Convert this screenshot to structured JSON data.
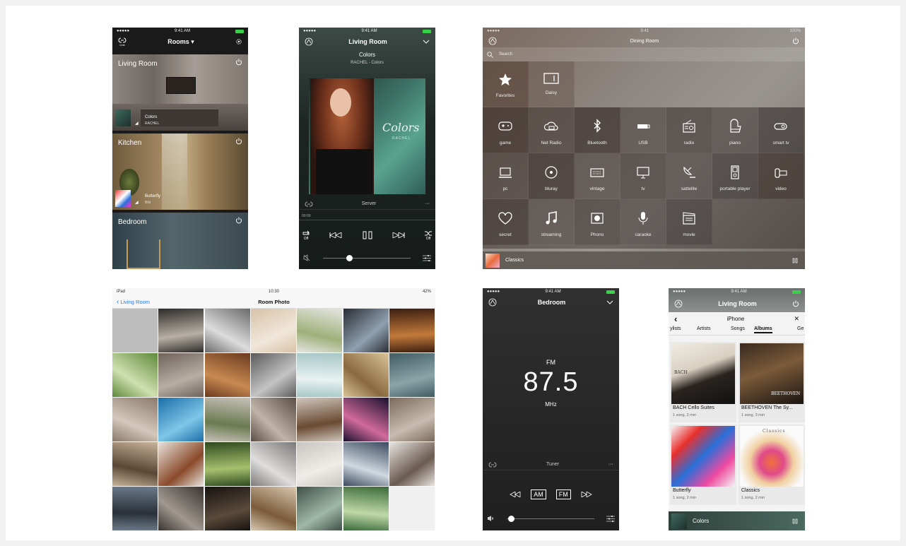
{
  "screen1": {
    "status": {
      "carrier": "●●●●● ",
      "time": "9:41 AM"
    },
    "header": {
      "link_label": "Link",
      "title": "Rooms ▾"
    },
    "rooms": [
      {
        "name": "Living Room",
        "track": "Colors",
        "artist": "RACHEL"
      },
      {
        "name": "Kitchen",
        "track": "Butterfly",
        "artist": "Bild"
      },
      {
        "name": "Bedroom"
      }
    ]
  },
  "screen2": {
    "status": {
      "carrier": "●●●●● ",
      "time": "9:41 AM"
    },
    "header": {
      "title": "Living Room"
    },
    "track": {
      "title": "Colors",
      "subtitle": "RACHEL - Colors"
    },
    "album_art_text": {
      "title": "Colors",
      "artist": "RACHEL"
    },
    "source_label": "Server",
    "more_label": "···",
    "elapsed": "00:00",
    "repeat_label": "Off",
    "shuffle_label": "Off",
    "volume": 0.3
  },
  "screen3": {
    "status": {
      "time": "9:41",
      "battery": "100%"
    },
    "header": {
      "title": "Dining Room"
    },
    "search": {
      "placeholder": "Search"
    },
    "top_items": [
      {
        "label": "Favorites",
        "icon": "star-icon"
      },
      {
        "label": "Daisy",
        "icon": "device-icon"
      }
    ],
    "sources": [
      {
        "label": "game",
        "icon": "gamepad-icon"
      },
      {
        "label": "Net Radio",
        "icon": "cloud-radio-icon"
      },
      {
        "label": "Bluetooth",
        "icon": "bluetooth-icon"
      },
      {
        "label": "USB",
        "icon": "usb-icon"
      },
      {
        "label": "radio",
        "icon": "radio-icon"
      },
      {
        "label": "piano",
        "icon": "piano-icon"
      },
      {
        "label": "smart tv",
        "icon": "smart-tv-icon"
      },
      {
        "label": "pc",
        "icon": "laptop-icon"
      },
      {
        "label": "bluray",
        "icon": "disc-icon"
      },
      {
        "label": "vintage",
        "icon": "vintage-icon"
      },
      {
        "label": "tv",
        "icon": "tv-icon"
      },
      {
        "label": "sattelite",
        "icon": "satellite-icon"
      },
      {
        "label": "portable player",
        "icon": "portable-player-icon"
      },
      {
        "label": "video",
        "icon": "video-icon"
      },
      {
        "label": "secret",
        "icon": "heart-icon"
      },
      {
        "label": "streaming",
        "icon": "music-note-icon"
      },
      {
        "label": "Phono",
        "icon": "phono-icon"
      },
      {
        "label": "caraoke",
        "icon": "microphone-icon"
      },
      {
        "label": "movie",
        "icon": "clapper-icon"
      }
    ],
    "now_playing": {
      "title": "Classics"
    }
  },
  "screen4": {
    "status": {
      "device": "iPad",
      "time": "10:30",
      "battery": "42%"
    },
    "back_label": "Living Room",
    "title": "Room Photo"
  },
  "screen5": {
    "status": {
      "carrier": "●●●●● ",
      "time": "9:41 AM"
    },
    "header": {
      "title": "Bedroom"
    },
    "band": "FM",
    "frequency": "87.5",
    "unit": "MHz",
    "source_label": "Tuner",
    "more_label": "···",
    "am_label": "AM",
    "fm_label": "FM",
    "volume": 0.05
  },
  "screen6": {
    "status": {
      "carrier": "●●●●● ",
      "time": "9:41 AM"
    },
    "header": {
      "title": "Living Room"
    },
    "subheader": {
      "title": "iPhone"
    },
    "tabs": [
      "ylists",
      "Artists",
      "Songs",
      "Albums",
      "Ge"
    ],
    "active_tab": "Albums",
    "albums": [
      {
        "title": "BACH Cello Suites",
        "meta": "1 song, 2 min",
        "cover_text": "BACH"
      },
      {
        "title": "BEETHOVEN  The Sy...",
        "meta": "1 song, 3 min",
        "cover_text": "BEETHOVEN"
      },
      {
        "title": "Butterfly",
        "meta": "1 song, 2 min"
      },
      {
        "title": "Classics",
        "meta": "1 song, 2 min",
        "cover_text": "Classics"
      }
    ],
    "now_playing": {
      "title": "Colors"
    }
  }
}
